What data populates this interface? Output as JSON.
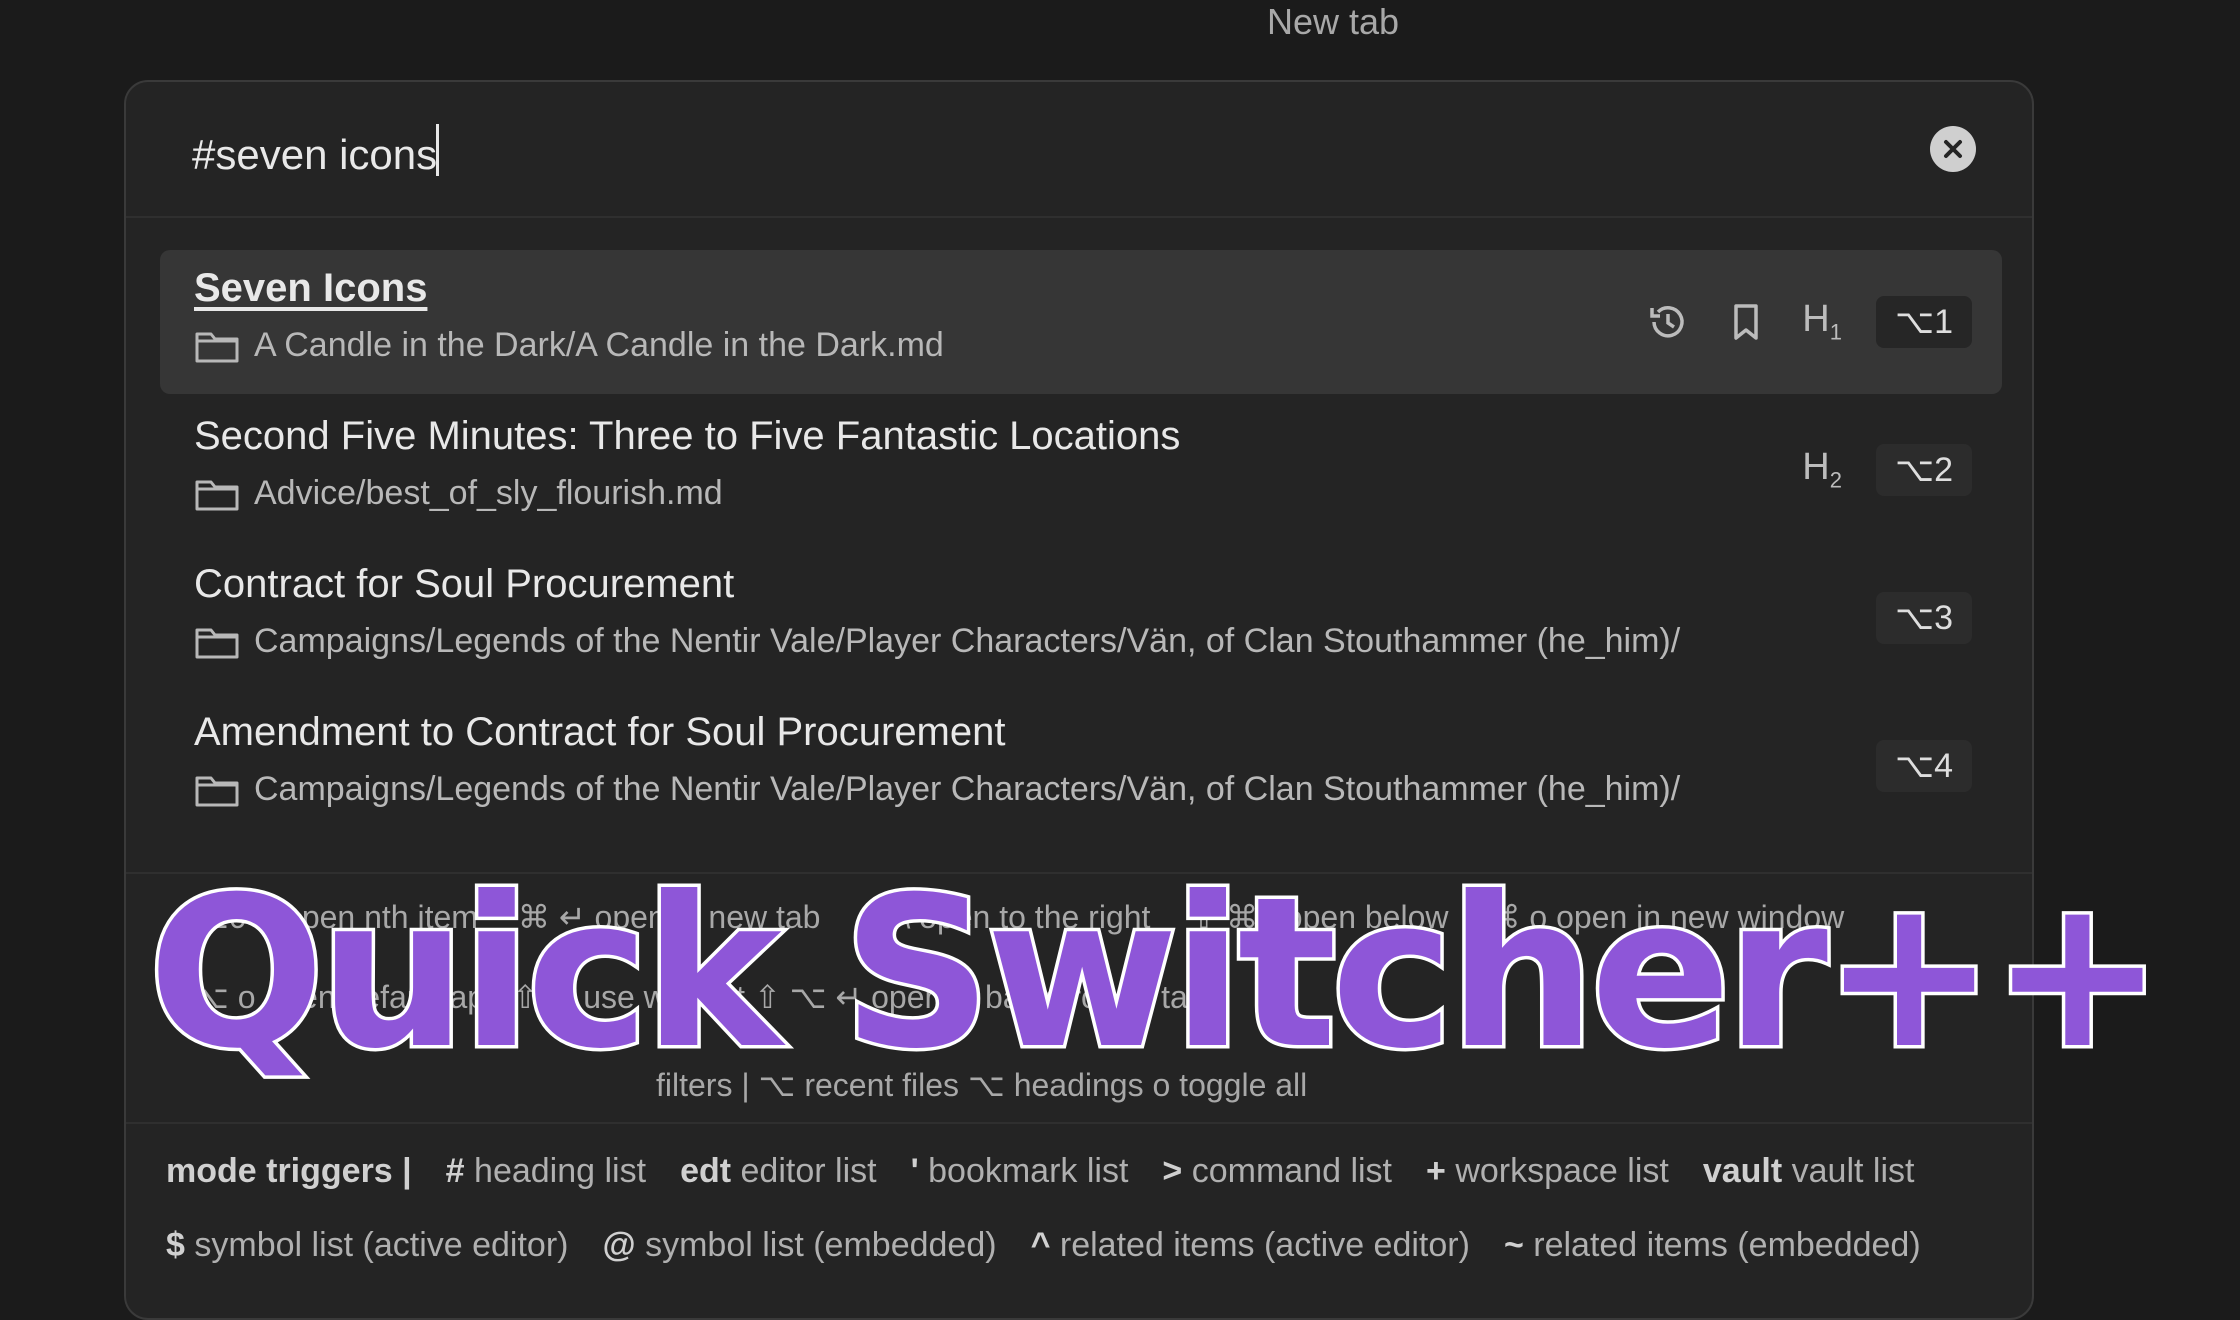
{
  "window": {
    "tab_title": "New tab"
  },
  "search": {
    "value": "#seven icons"
  },
  "results": [
    {
      "title": "Seven Icons",
      "path": "A Candle in the Dark/A Candle in the Dark.md",
      "heading_level": "H",
      "heading_sub": "1",
      "hotkey": "⌥1",
      "icons": [
        "history-icon",
        "bookmark-icon"
      ]
    },
    {
      "title": "Second Five Minutes: Three to Five Fantastic Locations",
      "path": "Advice/best_of_sly_flourish.md",
      "heading_level": "H",
      "heading_sub": "2",
      "hotkey": "⌥2"
    },
    {
      "title": "Contract for Soul Procurement",
      "path": "Campaigns/Legends of the Nentir Vale/Player Characters/Vän, of Clan Stouthammer (he_him)/",
      "hotkey": "⌥3"
    },
    {
      "title": "Amendment to Contract for Soul Procurement",
      "path": "Campaigns/Legends of the Nentir Vale/Player Characters/Vän, of Clan Stouthammer (he_him)/",
      "hotkey": "⌥4"
    }
  ],
  "instructions": {
    "line1": [
      "⌥0-9 open nth item",
      "⌘ ↵ open in new tab",
      "⌘ \\ open to the right",
      "⇧ ⌘ \\ open below",
      "⌘ o open in new window"
    ],
    "line2": "⌥ o open default app   ⇧ ↵ use without ⇧ ⌥ ↵ open in background tab",
    "line3": "filters |   ⌥   recent files   ⌥ headings   o toggle all"
  },
  "mode_triggers": {
    "label": "mode triggers |",
    "row1": [
      {
        "key": "#",
        "text": "heading list"
      },
      {
        "key": "edt",
        "text": "editor list"
      },
      {
        "key": "'",
        "text": "bookmark list"
      },
      {
        "key": ">",
        "text": "command list"
      },
      {
        "key": "+",
        "text": "workspace list"
      },
      {
        "key": "vault",
        "text": "vault list"
      }
    ],
    "row2": [
      {
        "key": "$",
        "text": "symbol list (active editor)"
      },
      {
        "key": "@",
        "text": "symbol list (embedded)"
      },
      {
        "key": "^",
        "text": "related items (active editor)"
      },
      {
        "key": "~",
        "text": "related items (embedded)"
      }
    ]
  },
  "banner": {
    "text": "Quick Switcher++"
  },
  "colors": {
    "banner_fill": "#8e56d8",
    "banner_stroke": "#ffffff",
    "background": "#1b1b1b"
  }
}
